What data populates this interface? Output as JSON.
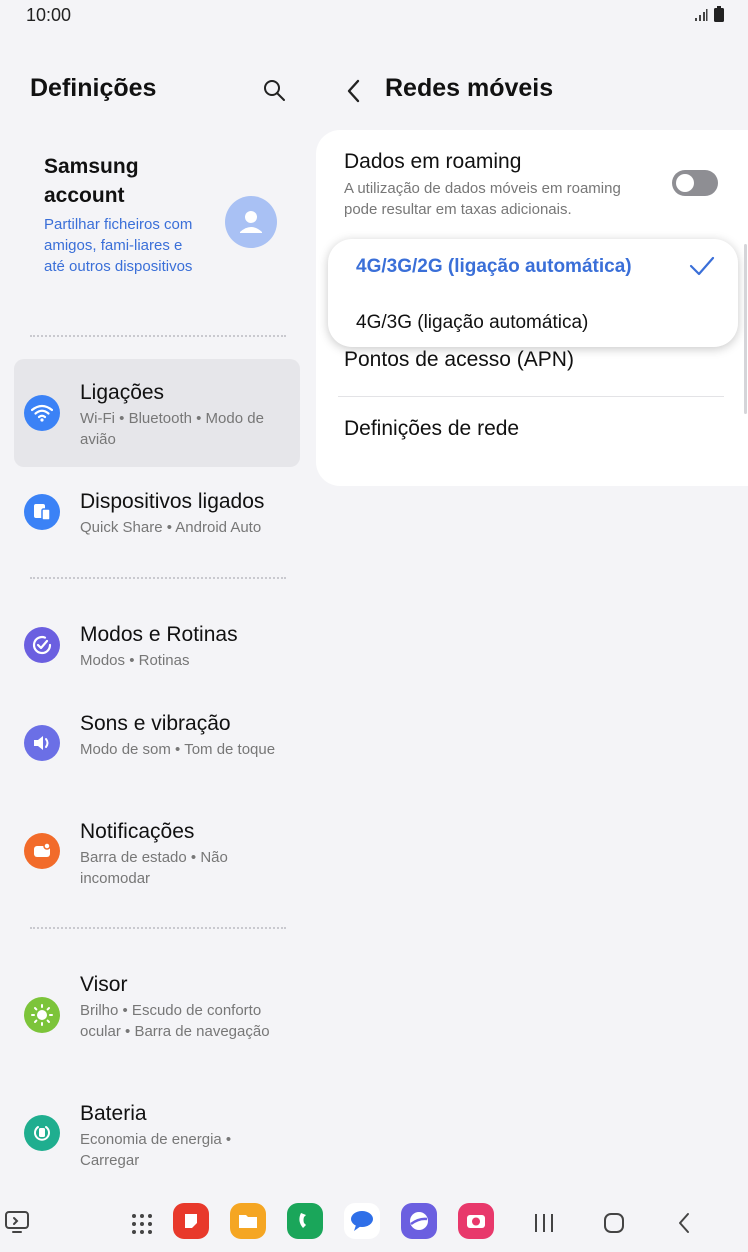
{
  "status_bar": {
    "time": "10:00"
  },
  "left_panel": {
    "title": "Definições",
    "account": {
      "name": "Samsung account",
      "description": "Partilhar ficheiros com amigos, fami-liares e até outros dispositivos"
    },
    "items": [
      {
        "title": "Ligações",
        "subtitle": "Wi-Fi • Bluetooth • Modo de avião",
        "icon": "wifi-icon",
        "color": "#3b82f6"
      },
      {
        "title": "Dispositivos ligados",
        "subtitle": "Quick Share • Android Auto",
        "icon": "devices-icon",
        "color": "#3b82f6"
      },
      {
        "title": "Modos e Rotinas",
        "subtitle": "Modos • Rotinas",
        "icon": "modes-check-icon",
        "color": "#6b5fe0"
      },
      {
        "title": "Sons e vibração",
        "subtitle": "Modo de som • Tom de toque",
        "icon": "speaker-icon",
        "color": "#6b6fe6"
      },
      {
        "title": "Notificações",
        "subtitle": "Barra de estado • Não incomodar",
        "icon": "notification-icon",
        "color": "#f26b2a"
      },
      {
        "title": "Visor",
        "subtitle": "Brilho • Escudo de conforto ocular • Barra de navegação",
        "icon": "sun-icon",
        "color": "#7cc43a"
      },
      {
        "title": "Bateria",
        "subtitle": "Economia de energia • Carregar",
        "icon": "battery-icon",
        "color": "#1fae8f"
      }
    ]
  },
  "right_panel": {
    "title": "Redes móveis",
    "roaming": {
      "title": "Dados em roaming",
      "description": "A utilização de dados móveis em roaming pode resultar em taxas adicionais.",
      "enabled": false
    },
    "dropdown": {
      "options": [
        "4G/3G/2G (ligação automática)",
        "4G/3G (ligação automática)"
      ],
      "selected": "4G/3G/2G (ligação automática)"
    },
    "apn": "Pontos de acesso (APN)",
    "network_settings": "Definições de rede"
  },
  "colors": {
    "accent": "#3a6fd8",
    "background": "#f4f4f7"
  }
}
